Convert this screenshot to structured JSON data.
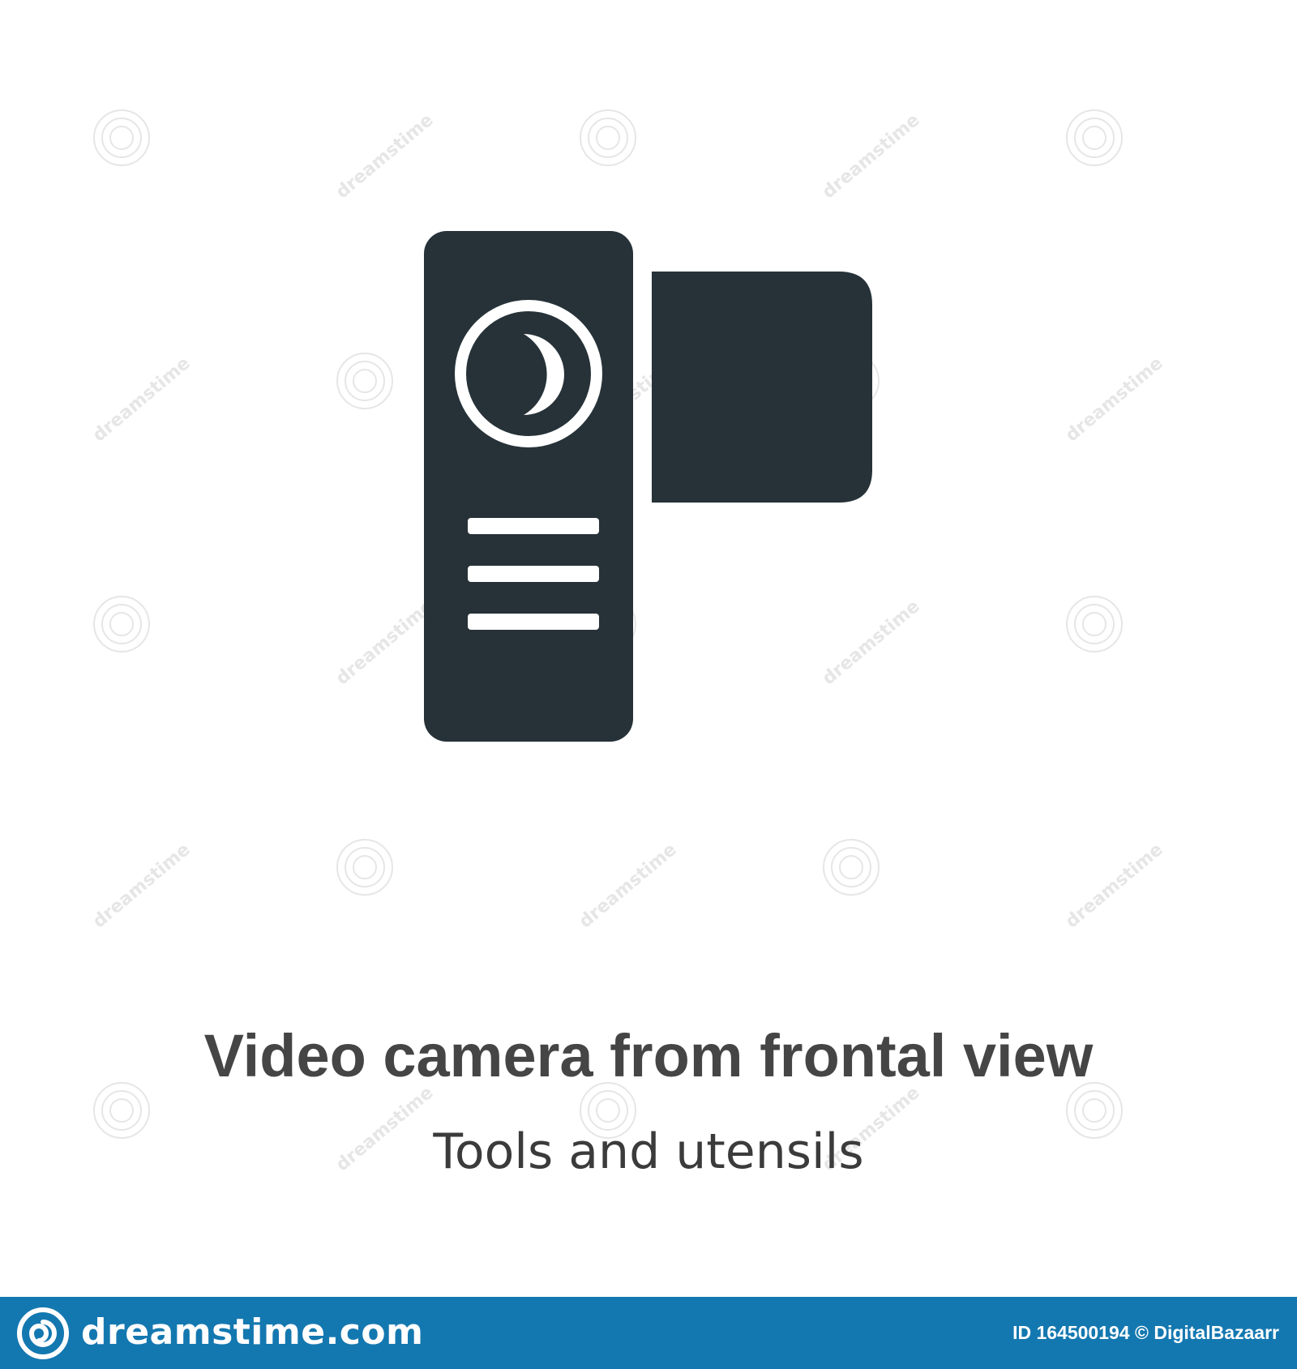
{
  "title": "Video camera from frontal view",
  "subtitle": "Tools and utensils",
  "watermark_text": "dreamstime",
  "icon": {
    "name": "video-camera-frontal-icon",
    "color": "#263238"
  },
  "footer": {
    "brand": "dreamstime.com",
    "brand_icon": "dreamstime-spiral-icon",
    "credit_id": "ID 164500194",
    "credit_copyright": "©",
    "credit_author": "DigitalBazaarr",
    "background_color": "#1478b0"
  }
}
